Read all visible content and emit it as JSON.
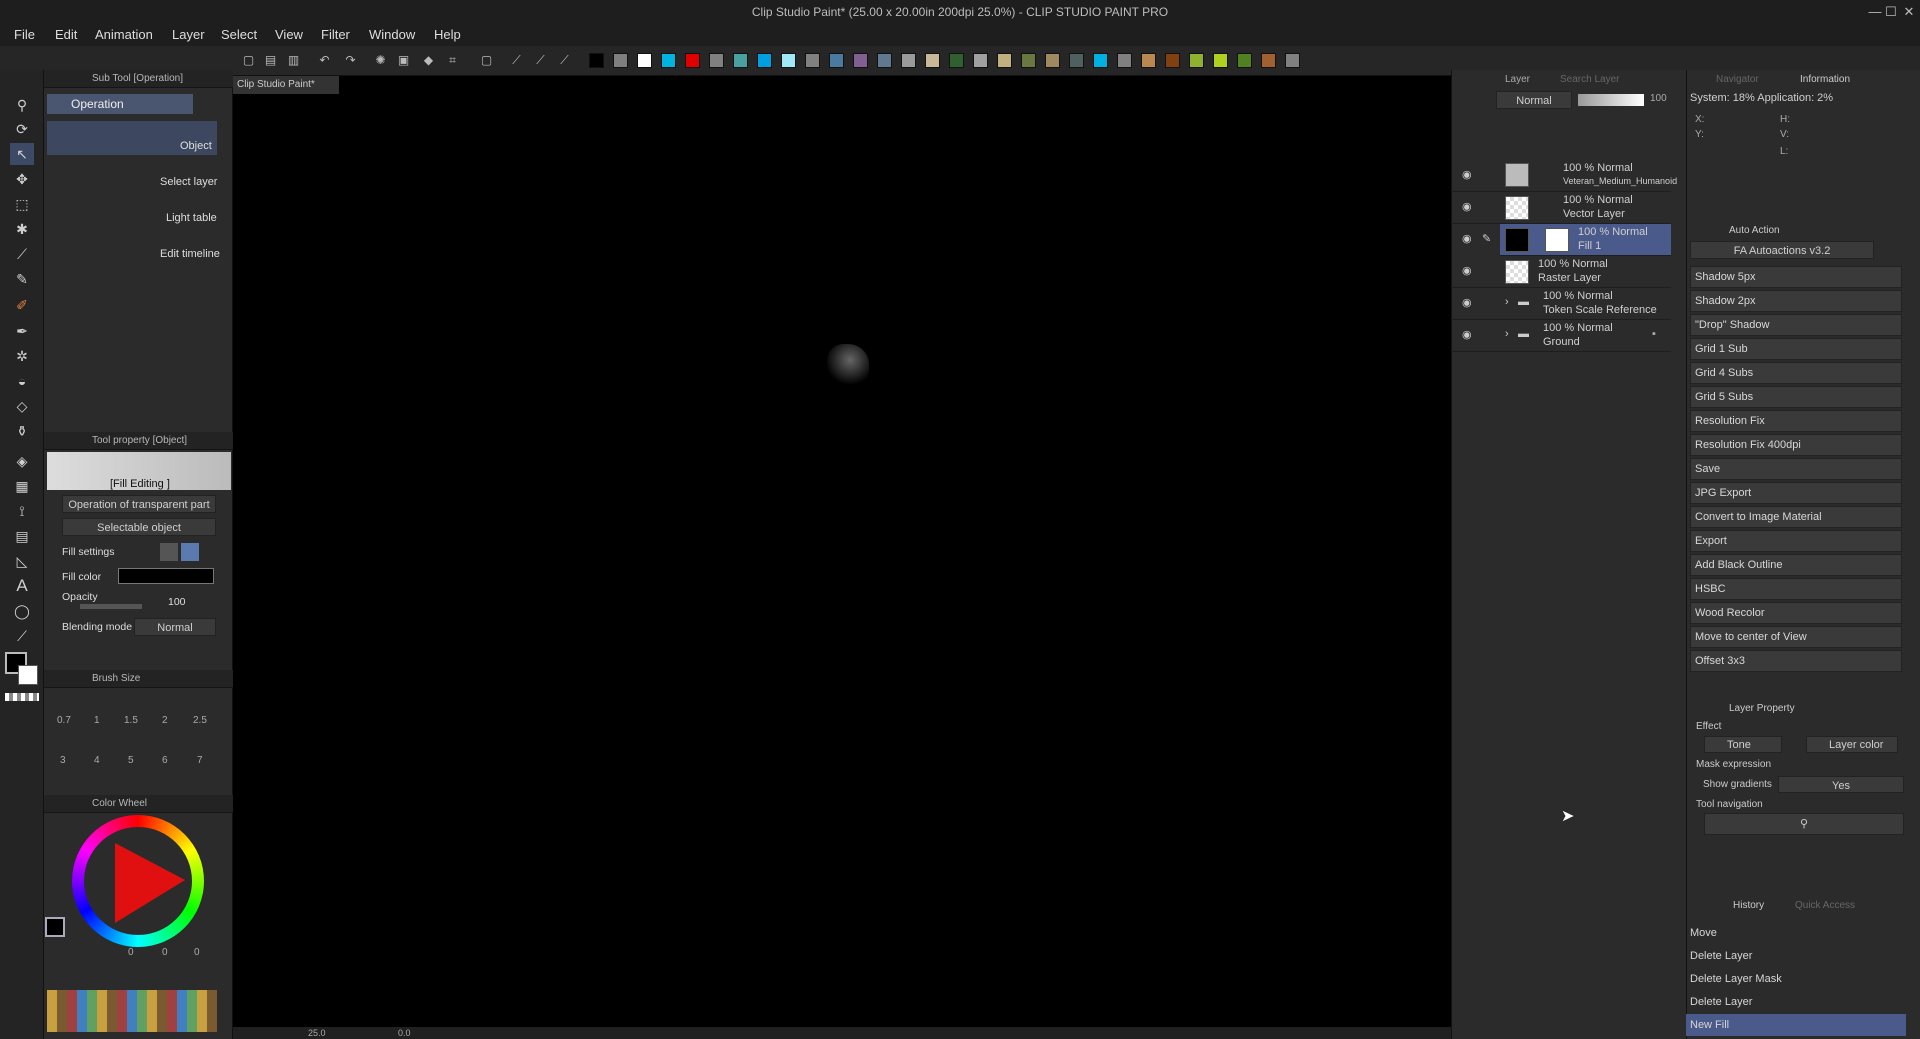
{
  "window": {
    "title": "Clip Studio Paint* (25.00 x 20.00in 200dpi 25.0%) - CLIP STUDIO PAINT PRO",
    "minimize": "—",
    "maximize": "☐",
    "close": "✕"
  },
  "menu": [
    "File",
    "Edit",
    "Animation",
    "Layer",
    "Select",
    "View",
    "Filter",
    "Window",
    "Help"
  ],
  "palette_colors": [
    "#000000",
    "#7f7f7f",
    "#ffffff",
    "#00b4e0",
    "#e00000",
    "#808080",
    "#4aa0a0",
    "#00a0e0",
    "#a0e8f8",
    "#808080",
    "#4a7aa0",
    "#806090",
    "#607890",
    "#9a9a9a",
    "#c8b898",
    "#306030",
    "#a0a0a0",
    "#c0b080",
    "#687840",
    "#a08860",
    "#506060",
    "#00b0e0",
    "#808080",
    "#b88850",
    "#804010",
    "#90b030",
    "#b0d020",
    "#508020",
    "#a06030",
    "#808080"
  ],
  "subtool": {
    "header": "Sub Tool [Operation]",
    "group": "Operation",
    "items": [
      "Object",
      "Select layer",
      "Light table",
      "Edit timeline"
    ]
  },
  "tool_property": {
    "header": "Tool property [Object]",
    "preview_label": "[Fill Editing ]",
    "transparent_part": "Operation of transparent part",
    "selectable_object": "Selectable object",
    "fill_settings": "Fill settings",
    "fill_color": "Fill color",
    "opacity_label": "Opacity",
    "opacity_value": "100",
    "blending_label": "Blending mode",
    "blending_value": "Normal"
  },
  "brush_size": {
    "header": "Brush Size",
    "sizes": [
      "0.7",
      "1",
      "1.5",
      "2",
      "2.5",
      "3",
      "4",
      "5",
      "6",
      "7"
    ]
  },
  "color_wheel": {
    "header": "Color Wheel",
    "values": [
      "0",
      "0",
      "0"
    ]
  },
  "doc_tab": "Clip Studio Paint*",
  "statusbar": {
    "zoom": "25.0",
    "angle": "0.0"
  },
  "layer_panel": {
    "tab_layer": "Layer",
    "tab_search": "Search Layer",
    "blend_mode": "Normal",
    "opacity": "100",
    "layers": [
      {
        "line1": "100 % Normal",
        "line2": "Veteran_Medium_Humanoid"
      },
      {
        "line1": "100 % Normal",
        "line2": "Vector Layer"
      },
      {
        "line1": "100 % Normal",
        "line2": "Fill 1"
      },
      {
        "line1": "100 % Normal",
        "line2": "Raster Layer"
      },
      {
        "line1": "100 % Normal",
        "line2": "Token Scale Reference"
      },
      {
        "line1": "100 % Normal",
        "line2": "Ground"
      }
    ]
  },
  "navigator": {
    "tab_navigator": "Navigator",
    "tab_information": "Information",
    "system": "System: 18%  Application:  2%",
    "x": "X:",
    "y": "Y:",
    "h": "H:",
    "v": "V:",
    "l": "L:"
  },
  "auto_action": {
    "header": "Auto Action",
    "set": "FA Autoactions v3.2",
    "items": [
      "Shadow 5px",
      "Shadow 2px",
      "\"Drop\" Shadow",
      "Grid 1 Sub",
      "Grid 4 Subs",
      "Grid 5 Subs",
      "Resolution Fix",
      "Resolution Fix 400dpi",
      "Save",
      "JPG Export",
      "Convert to Image Material",
      "Export",
      "Add Black Outline",
      "HSBC",
      "Wood Recolor",
      "Move to center of View",
      "Offset 3x3"
    ]
  },
  "layer_property": {
    "header": "Layer Property",
    "effect": "Effect",
    "tone": "Tone",
    "layer_color": "Layer color",
    "mask_expression": "Mask expression",
    "show_gradients": "Show gradients",
    "show_gradients_value": "Yes",
    "tool_navigation": "Tool navigation"
  },
  "history": {
    "tab_history": "History",
    "tab_quick": "Quick Access",
    "items": [
      "Move",
      "Delete Layer",
      "Delete Layer Mask",
      "Delete Layer",
      "New Fill"
    ]
  }
}
